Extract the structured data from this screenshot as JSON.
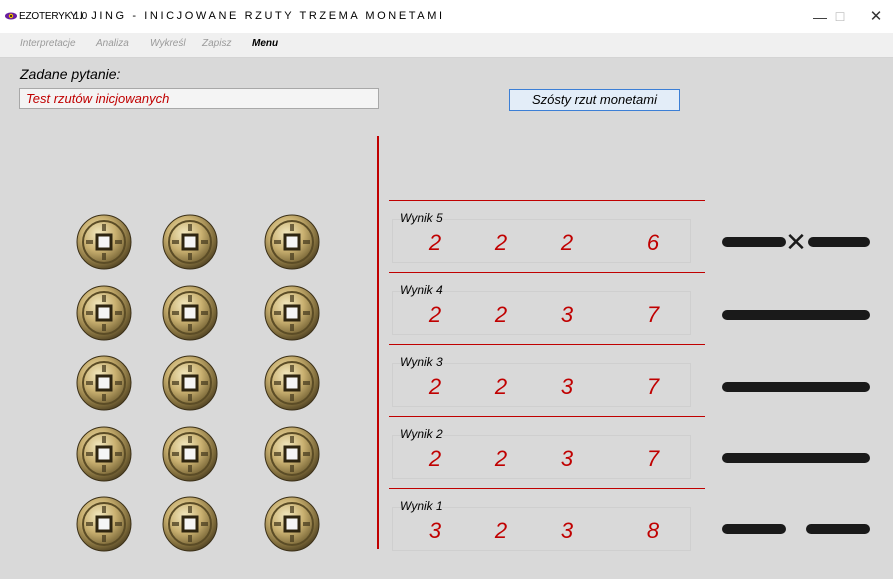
{
  "window": {
    "app_name": "EZOTERYK 1.0",
    "title": "YI JING - INICJOWANE RZUTY TRZEMA MONETAMI",
    "minimize_glyph": "—",
    "maximize_glyph": "☐",
    "close_glyph": "✕"
  },
  "menu": [
    "Interpretacje",
    "Analiza",
    "Wykreśl",
    "Zapisz",
    "Menu"
  ],
  "question": {
    "label": "Zadane pytanie:",
    "value": "Test rzutów inicjowanych"
  },
  "throw_button": "Szósty rzut monetami",
  "results": [
    {
      "label": "Wynik 5",
      "coins": [
        "2",
        "2",
        "2"
      ],
      "sum": "6",
      "line": "changing-yin"
    },
    {
      "label": "Wynik 4",
      "coins": [
        "2",
        "2",
        "3"
      ],
      "sum": "7",
      "line": "yang"
    },
    {
      "label": "Wynik 3",
      "coins": [
        "2",
        "2",
        "3"
      ],
      "sum": "7",
      "line": "yang"
    },
    {
      "label": "Wynik 2",
      "coins": [
        "2",
        "2",
        "3"
      ],
      "sum": "7",
      "line": "yang"
    },
    {
      "label": "Wynik 1",
      "coins": [
        "3",
        "2",
        "3"
      ],
      "sum": "8",
      "line": "yin"
    }
  ],
  "changing_mark": "✕",
  "colors": {
    "accent": "#c00000",
    "line": "#1a1a1a",
    "button_border": "#3c7fd6"
  },
  "icons": {
    "app": "eye-icon",
    "coin": "chinese-coin-icon"
  }
}
